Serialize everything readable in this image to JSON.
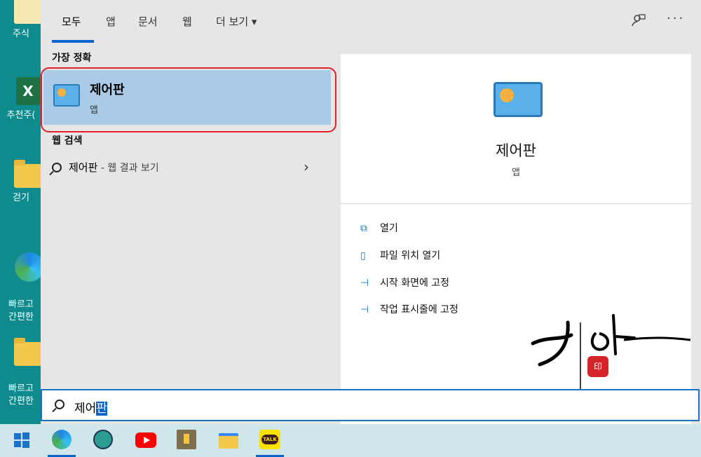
{
  "desktop": {
    "icons": [
      {
        "label": "주식"
      },
      {
        "label": "추천주("
      },
      {
        "label": "걷기"
      },
      {
        "label": "빠르고\n간편한"
      },
      {
        "label": "빠르고\n간편한"
      }
    ]
  },
  "tabs": [
    {
      "label": "모두"
    },
    {
      "label": "앱"
    },
    {
      "label": "문서"
    },
    {
      "label": "웹"
    },
    {
      "label": "더 보기 ▾"
    }
  ],
  "sections": {
    "best_match": "가장 정확",
    "web_search": "웹 검색"
  },
  "best_match": {
    "title": "제어판",
    "type": "앱"
  },
  "web_result": {
    "query": "제어판",
    "suffix": " - 웹 결과 보기"
  },
  "preview": {
    "name": "제어판",
    "type": "앱",
    "actions": [
      {
        "label": "열기",
        "icon": "open-icon"
      },
      {
        "label": "파일 위치 열기",
        "icon": "file-location-icon"
      },
      {
        "label": "시작 화면에 고정",
        "icon": "pin-icon"
      },
      {
        "label": "작업 표시줄에 고정",
        "icon": "pin-icon"
      }
    ]
  },
  "search": {
    "text_before": "제어",
    "text_selected": "판"
  },
  "taskbar": {
    "apps": [
      "edge",
      "photos",
      "youtube",
      "notes",
      "file-explorer",
      "kakaotalk"
    ],
    "kakao_label": "TALK"
  },
  "colors": {
    "accent": "#0a63c9",
    "highlight": "#a9cbe8",
    "red_outline": "#e0202a"
  }
}
